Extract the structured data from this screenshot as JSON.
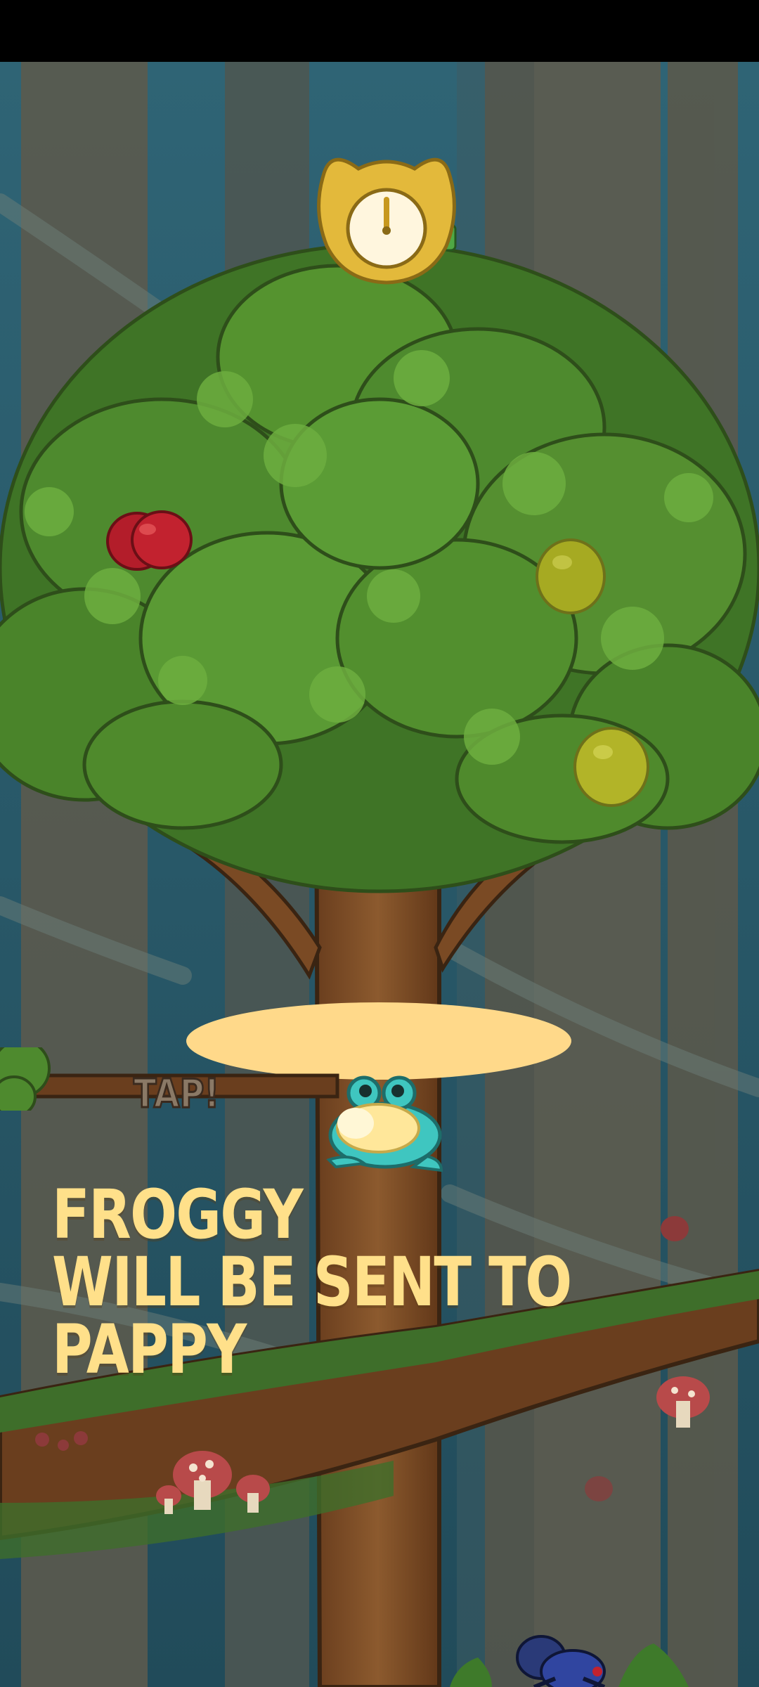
{
  "game": {
    "tap_hint": "TAP!",
    "message_lines": [
      "FROGGY",
      "WILL BE SENT TO",
      "PAPPY"
    ]
  },
  "icons": {
    "timer": "stopwatch-icon",
    "frog": "frog-character",
    "spider": "spider-enemy"
  },
  "colors": {
    "text": "#FFE08A",
    "sky": "#2F6475",
    "leaf": "#4E8A2E",
    "trunk": "#7A4A24",
    "bubble": "#FFD98A",
    "frog": "#3FC6C0"
  }
}
